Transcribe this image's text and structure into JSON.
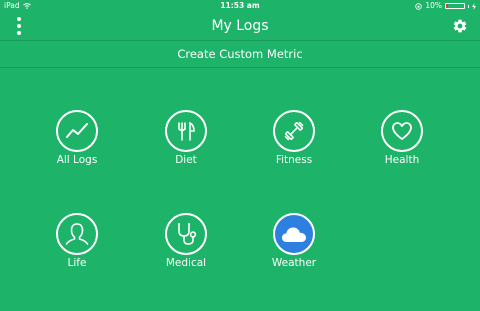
{
  "status_bar": {
    "device": "iPad",
    "time": "11:53 am",
    "battery": "10%"
  },
  "nav": {
    "title": "My Logs"
  },
  "custom_metric": {
    "label": "Create Custom Metric"
  },
  "tiles": [
    {
      "label": "All Logs",
      "icon": "trend-line-icon"
    },
    {
      "label": "Diet",
      "icon": "fork-knife-icon"
    },
    {
      "label": "Fitness",
      "icon": "dumbbell-icon"
    },
    {
      "label": "Health",
      "icon": "heart-icon"
    },
    {
      "label": "Life",
      "icon": "person-icon"
    },
    {
      "label": "Medical",
      "icon": "stethoscope-icon"
    },
    {
      "label": "Weather",
      "icon": "cloud-icon"
    }
  ],
  "colors": {
    "background": "#1db368",
    "weather_circle": "#2d7fe0",
    "battery_low": "#e53935"
  }
}
